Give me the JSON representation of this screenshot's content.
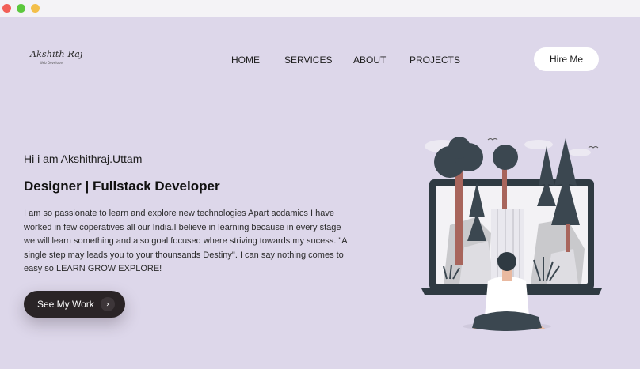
{
  "window": {
    "controls": [
      "close",
      "minimize",
      "zoom"
    ]
  },
  "logo": {
    "name": "Akshith Raj",
    "tagline": "Web Developer"
  },
  "nav": {
    "items": [
      {
        "label": "HOME"
      },
      {
        "label": "SERVICES"
      },
      {
        "label": "ABOUT"
      },
      {
        "label": "PROJECTS"
      }
    ]
  },
  "header": {
    "hire_label": "Hire Me"
  },
  "hero": {
    "greeting": "Hi i am Akshithraj.Uttam",
    "role": "Designer | Fullstack Developer",
    "bio": "I am so passionate to learn and explore new technologies Apart acdamics I have worked in few coperatives all our India.I believe in learning because in every stage we will learn something and also goal focused where striving towards my sucess. \"A single step may leads you to your thounsands Destiny\". I can say nothing comes to easy so LEARN GROW EXPLORE!",
    "cta_label": "See My Work"
  },
  "colors": {
    "background": "#ddd7ea",
    "button_dark": "#2a2426",
    "tree_dark": "#3b4750",
    "trunk": "#a8655c"
  },
  "icons": {
    "cta_arrow": "chevron-right-icon",
    "illustration": "developer-laptop-illustration"
  }
}
